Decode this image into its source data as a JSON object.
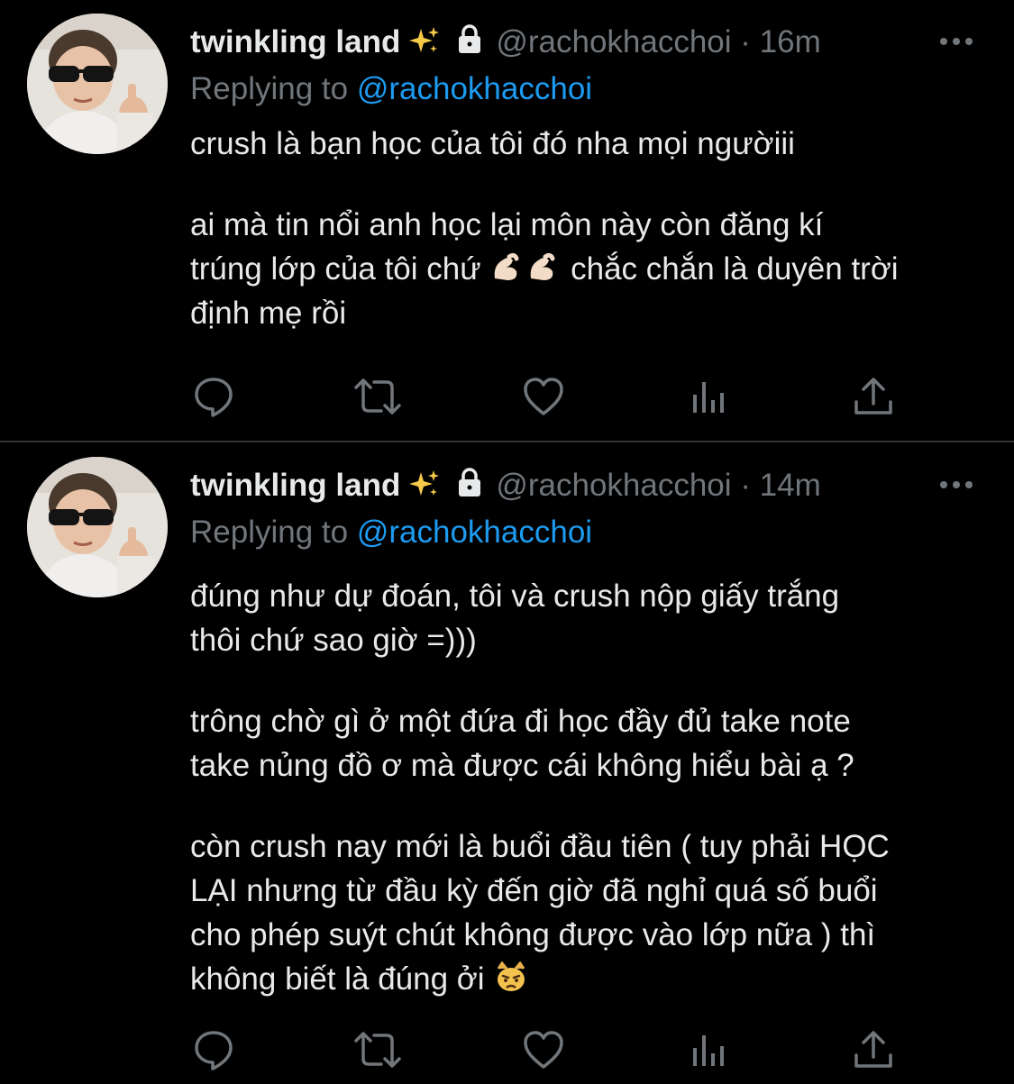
{
  "colors": {
    "background": "#000000",
    "text": "#e7e9ea",
    "muted": "#71767b",
    "mention": "#1d9bf0",
    "divider": "#2f3336"
  },
  "tweets": [
    {
      "display_name": "twinkling land",
      "badge_icon": "sparkles-icon",
      "protected_icon": "lock-icon",
      "handle": "@rachokhacchoi",
      "separator": "·",
      "time": "16m",
      "replying_prefix": "Replying to",
      "replying_mention": "@rachokhacchoi",
      "paragraphs": [
        "crush là bạn học của tôi đó nha mọi ngườiii",
        "ai mà tin nổi anh học lại môn này còn đăng kí\ntrúng lớp của tôi chứ",
        "chắc chắn là duyên trời\nđịnh mẹ rồi"
      ],
      "inline_emoji": "flexed-biceps-emoji"
    },
    {
      "display_name": "twinkling land",
      "badge_icon": "sparkles-icon",
      "protected_icon": "lock-icon",
      "handle": "@rachokhacchoi",
      "separator": "·",
      "time": "14m",
      "replying_prefix": "Replying to",
      "replying_mention": "@rachokhacchoi",
      "paragraphs": [
        "đúng như dự đoán, tôi và crush nộp giấy trắng\nthôi chứ sao giờ =)))",
        "trông chờ gì ở một đứa đi học đầy đủ take note\ntake nủng đồ ơ mà được cái không hiểu bài ạ ?",
        "còn crush nay mới là buổi đầu tiên ( tuy phải HỌC\nLẠI nhưng từ đầu kỳ đến giờ đã nghỉ quá số buổi\ncho phép suýt chút không được vào lớp nữa ) thì\nkhông biết là đúng ởi"
      ],
      "inline_emoji": "pouting-cat-emoji"
    }
  ],
  "action_icons": [
    "reply-icon",
    "retweet-icon",
    "like-icon",
    "analytics-icon",
    "share-icon"
  ]
}
